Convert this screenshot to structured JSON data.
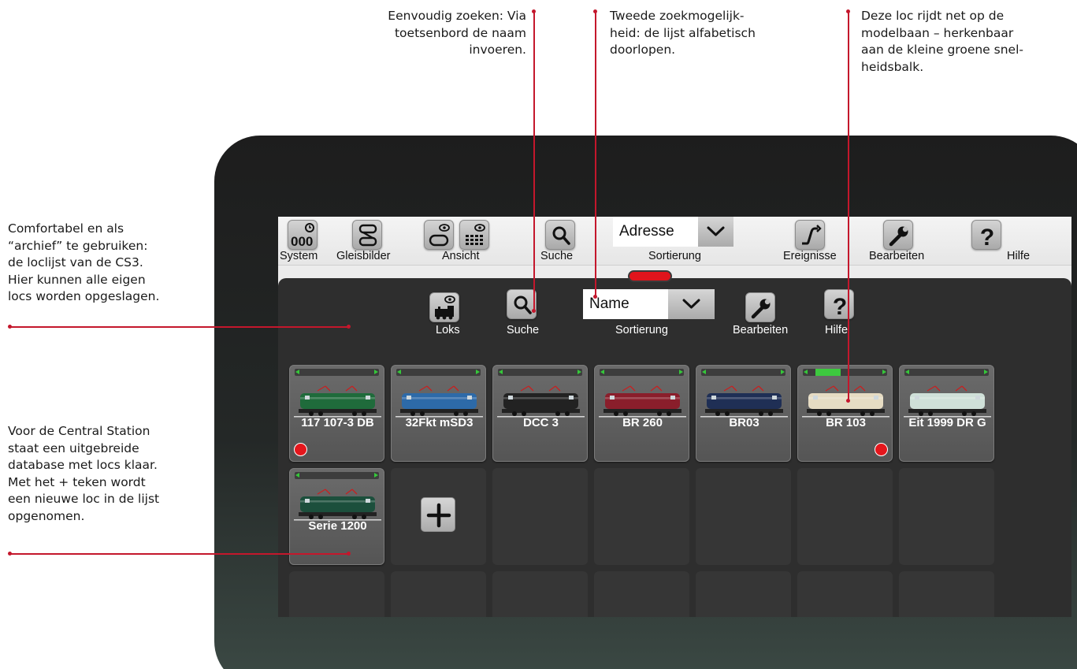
{
  "annotations": {
    "search_simple": [
      "Eenvoudig zoeken: Via",
      "toetsenbord de naam",
      "invoeren."
    ],
    "search_alpha": [
      "Tweede zoekmogelijk-",
      "heid: de lijst alfabetisch",
      "doorlopen."
    ],
    "running_loco": [
      "Deze loc rijdt net op de",
      "modelbaan – herkenbaar",
      "aan de kleine groene snel-",
      "heidsbalk."
    ],
    "archive": [
      "Comfortabel en als",
      "“archief” te gebruiken:",
      "de loclijst van de CS3.",
      "Hier kunnen alle eigen",
      "locs worden opgeslagen."
    ],
    "database": [
      "Voor de Central Station",
      "staat een uitgebreide",
      "database met locs klaar.",
      "Met het + teken wordt",
      "een nieuwe loc in de lijst",
      "opgenomen."
    ]
  },
  "toolbar": {
    "system": "System",
    "gleisbilder": "Gleisbilder",
    "ansicht": "Ansicht",
    "suche": "Suche",
    "sort_value": "Adresse",
    "sortierung": "Sortierung",
    "ereignisse": "Ereignisse",
    "bearbeiten": "Bearbeiten",
    "hilfe": "Hilfe"
  },
  "panel": {
    "loks": "Loks",
    "suche": "Suche",
    "sort_value": "Name",
    "sortierung": "Sortierung",
    "bearbeiten": "Bearbeiten",
    "hilfe": "Hilfe"
  },
  "locos": [
    {
      "name": "117 107-3 DB",
      "speed": 0,
      "active": true,
      "body_color": "#1f6b3b"
    },
    {
      "name": "32Fkt mSD3",
      "speed": 0,
      "active": false,
      "body_color": "#2d6aa8"
    },
    {
      "name": "DCC 3",
      "speed": 0,
      "active": false,
      "body_color": "#222222"
    },
    {
      "name": "BR 260",
      "speed": 0,
      "active": false,
      "body_color": "#8a1e2b"
    },
    {
      "name": "BR03",
      "speed": 0,
      "active": false,
      "body_color": "#1f2f55"
    },
    {
      "name": "BR 103",
      "speed": 0.3,
      "active": true,
      "body_color": "#e6dcc3"
    },
    {
      "name": "Eit 1999 DR G",
      "speed": 0,
      "active": false,
      "body_color": "#cfe0d8"
    },
    {
      "name": "Serie 1200",
      "speed": 0,
      "active": false,
      "body_color": "#1c4f3c"
    }
  ],
  "colors": {
    "accent_red": "#c4172c",
    "speed_green": "#3dc93f",
    "active_dot": "#e4161c"
  }
}
